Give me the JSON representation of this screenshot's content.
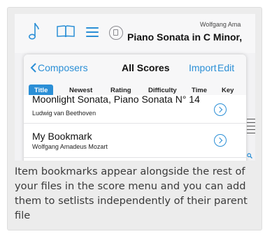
{
  "toolbar": {
    "icons": [
      "music-note-icon",
      "library-book-icon",
      "hamburger-menu-icon",
      "document-icon"
    ],
    "composer": "Wolfgang Ama",
    "score_title": "Piano Sonata in C Minor,"
  },
  "scores_panel": {
    "back_label": "Composers",
    "title": "All Scores",
    "import_label": "Import",
    "edit_label": "Edit",
    "sort_tabs": [
      "Title",
      "Newest",
      "Rating",
      "Difficulty",
      "Time",
      "Key"
    ],
    "active_sort": "Title",
    "rows": [
      {
        "title": "Moonlight Sonata, Piano Sonata N° 14",
        "subtitle": "Ludwig van Beethoven"
      },
      {
        "title": "My Bookmark",
        "subtitle": "Wolfgang Amadeus Mozart"
      }
    ]
  },
  "caption": "Item bookmarks appear alongside the rest of your files in the score menu and you can add them to setlists independently of their parent file",
  "colors": {
    "accent": "#2b8fd6",
    "card_bg": "#ececec",
    "panel_bg": "#ffffff"
  }
}
